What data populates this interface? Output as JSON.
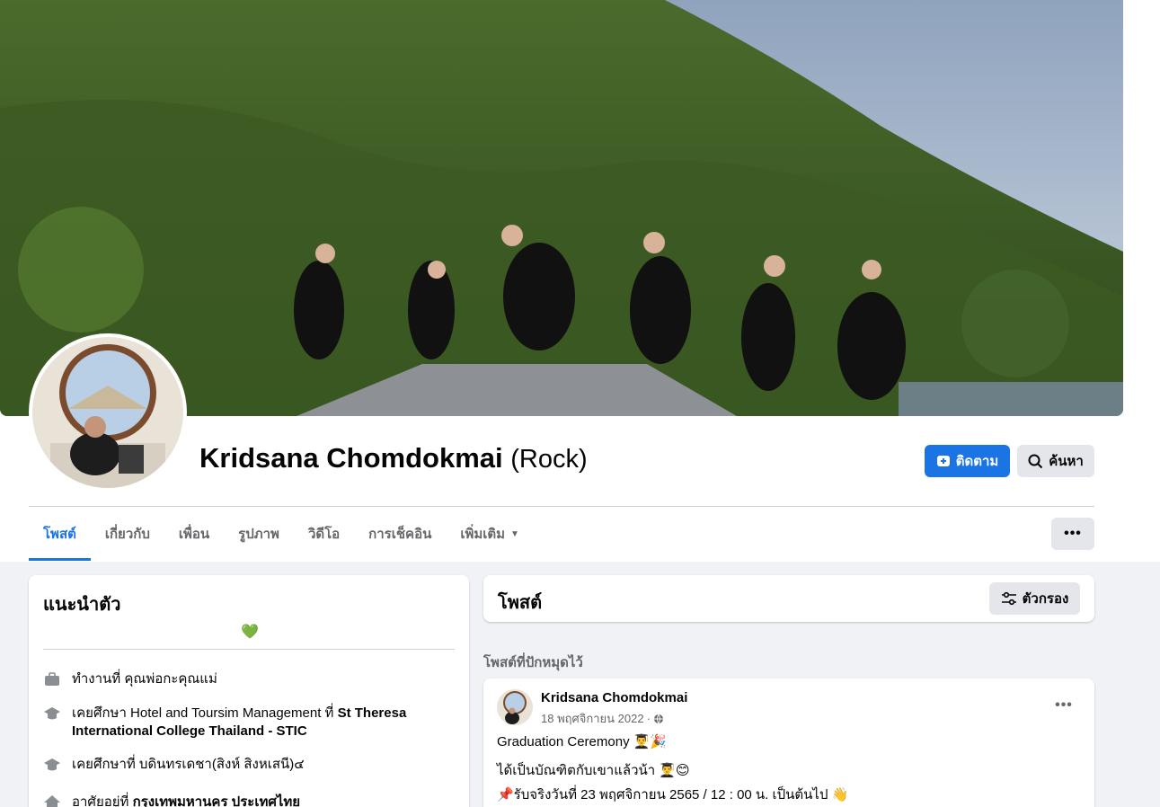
{
  "profile": {
    "name": "Kridsana Chomdokmai",
    "alternate_name": "(Rock)",
    "follow_label": "ติดตาม",
    "search_label": "ค้นหา"
  },
  "tabs": [
    {
      "label": "โพสต์",
      "active": true
    },
    {
      "label": "เกี่ยวกับ"
    },
    {
      "label": "เพื่อน"
    },
    {
      "label": "รูปภาพ"
    },
    {
      "label": "วิดีโอ"
    },
    {
      "label": "การเช็คอิน"
    },
    {
      "label": "เพิ่มเติม"
    }
  ],
  "intro": {
    "title": "แนะนำตัว",
    "bio": "💚",
    "items": [
      {
        "icon": "briefcase-icon",
        "prefix": "ทำงานที่ ",
        "value": "คุณพ่อกะคุณแม่",
        "value_bold": false
      },
      {
        "icon": "graduation-cap-icon",
        "prefix": "เคยศึกษา Hotel and Toursim Management ที่ ",
        "value": "St Theresa International College Thailand - STIC",
        "value_bold": true
      },
      {
        "icon": "graduation-cap-icon",
        "prefix": "เคยศึกษาที่ ",
        "value": "บดินทรเดชา(สิงห์ สิงหเสนี)๔",
        "value_bold": false
      },
      {
        "icon": "home-icon",
        "prefix": "อาศัยอยู่ที่ ",
        "value": "กรุงเทพมหานคร ประเทศไทย",
        "value_bold": true
      }
    ]
  },
  "posts": {
    "title": "โพสต์",
    "filter_label": "ตัวกรอง",
    "pinned_label": "โพสต์ที่ปักหมุดไว้",
    "pinned_post": {
      "author": "Kridsana Chomdokmai",
      "date": "18 พฤศจิกายน 2022",
      "privacy_icon": "globe-icon",
      "lines": [
        "Graduation Ceremony 👨‍🎓🎉",
        "ได้เป็นบัณฑิตกับเขาแล้วน้า 👨‍🎓😊",
        "📌รับจริงวันที่ 23 พฤศจิกายน 2565 / 12 : 00 น. เป็นต้นไป 👋"
      ]
    }
  },
  "colors": {
    "accent": "#1b74e4",
    "page_bg": "#f0f2f5",
    "secondary_button": "#e4e6eb",
    "secondary_text": "#65676b"
  }
}
